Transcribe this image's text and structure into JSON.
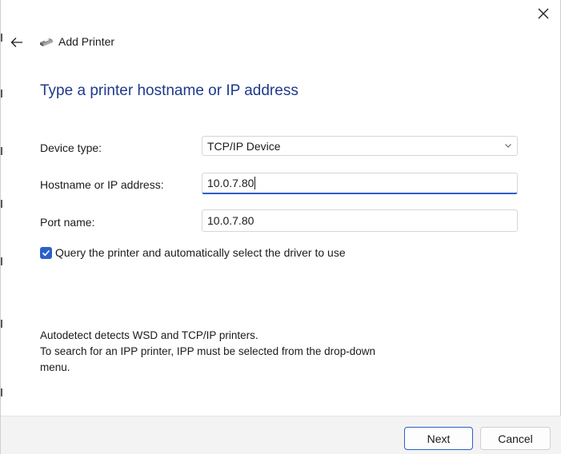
{
  "window": {
    "title": "Add Printer",
    "close_glyph": "✕",
    "back_icon": "back-arrow-icon",
    "printer_icon": "printer-icon"
  },
  "page": {
    "heading": "Type a printer hostname or IP address"
  },
  "form": {
    "device_type": {
      "label": "Device type:",
      "value": "TCP/IP Device"
    },
    "hostname": {
      "label": "Hostname or IP address:",
      "value": "10.0.7.80"
    },
    "port": {
      "label": "Port name:",
      "value": "10.0.7.80"
    },
    "query_checkbox": {
      "label": "Query the printer and automatically select the driver to use",
      "checked": true
    }
  },
  "info": {
    "line1": "Autodetect detects WSD and TCP/IP printers.",
    "line2": "To search for an IPP printer, IPP must be selected from the drop-down",
    "line3": "menu."
  },
  "footer": {
    "next_label": "Next",
    "cancel_label": "Cancel"
  },
  "colors": {
    "accent": "#2a61c8",
    "heading": "#1f3a8a",
    "footer_bg": "#f3f3f3"
  }
}
